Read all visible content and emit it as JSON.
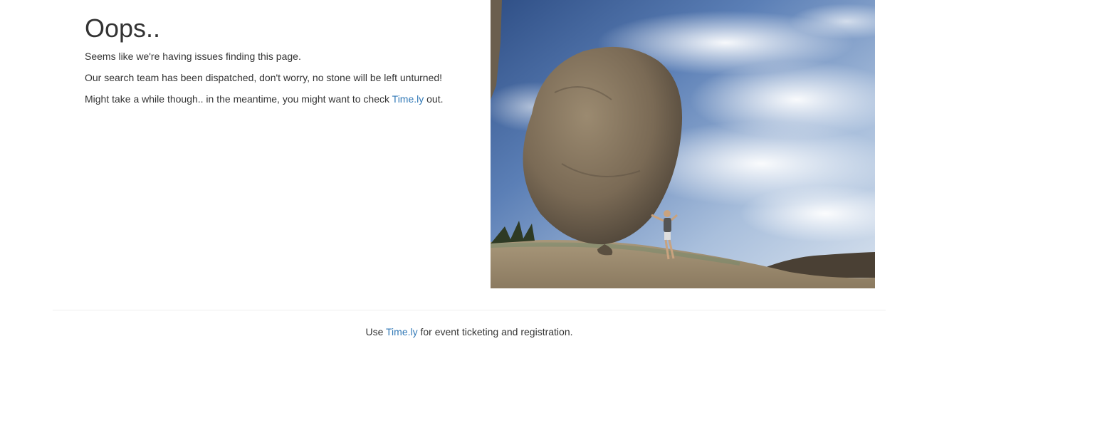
{
  "error": {
    "title": "Oops..",
    "line1": "Seems like we're having issues finding this page.",
    "line2": "Our search team has been dispatched, don't worry, no stone will be left unturned!",
    "line3_before": "Might take a while though.. in the meantime, you might want to check ",
    "line3_link": "Time.ly",
    "line3_after": " out."
  },
  "footer": {
    "before": "Use ",
    "link": "Time.ly",
    "after": " for event ticketing and registration."
  },
  "colors": {
    "text": "#333333",
    "link": "#337ab7",
    "divider": "#eeeeee"
  }
}
